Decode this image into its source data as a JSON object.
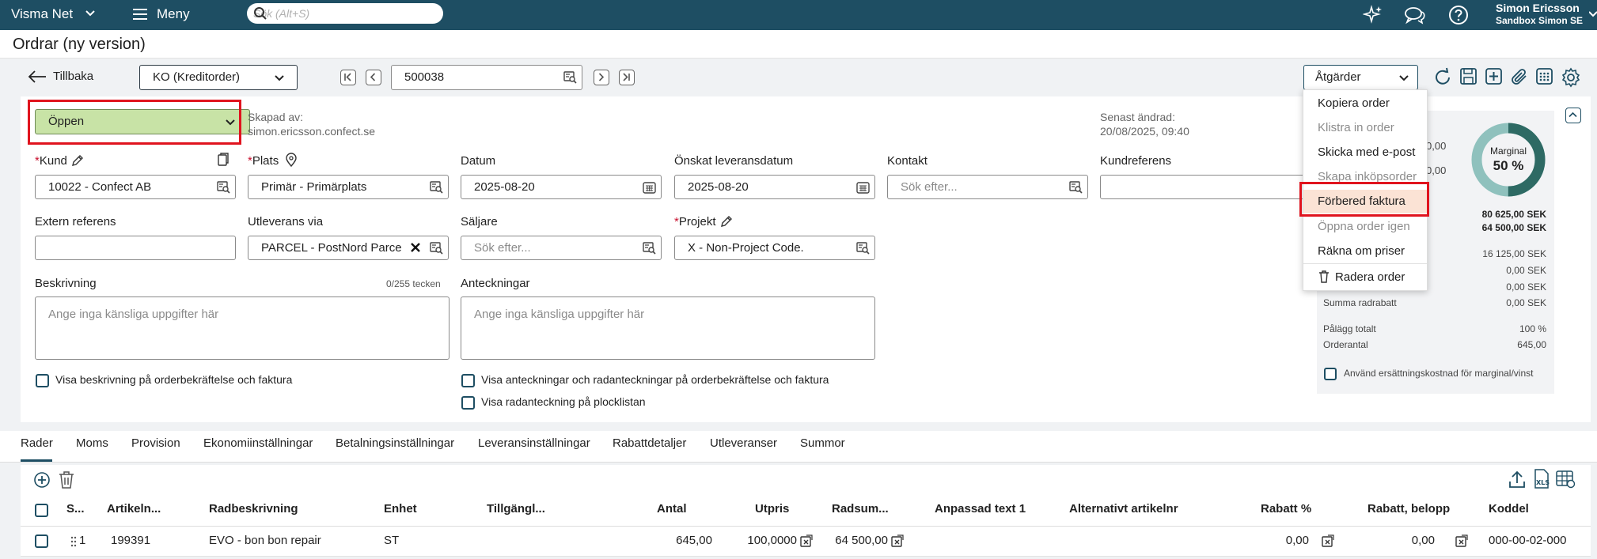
{
  "topbar": {
    "app_name": "Visma Net",
    "menu_label": "Meny",
    "search_placeholder": "Sök (Alt+S)",
    "user_name": "Simon Ericsson",
    "company": "Sandbox Simon SE"
  },
  "page": {
    "title": "Ordrar (ny version)"
  },
  "toolbar": {
    "back_label": "Tillbaka",
    "order_type": "KO (Kreditorder)",
    "order_number": "500038",
    "actions_label": "Åtgärder"
  },
  "actions_menu": {
    "items": [
      {
        "label": "Kopiera order",
        "disabled": false
      },
      {
        "label": "Klistra in order",
        "disabled": true
      },
      {
        "label": "Skicka med e-post",
        "disabled": false
      },
      {
        "label": "Skapa inköpsorder",
        "disabled": true
      },
      {
        "label": "Förbered faktura",
        "disabled": false,
        "highlighted": true
      },
      {
        "label": "Öppna order igen",
        "disabled": true
      },
      {
        "label": "Räkna om priser",
        "disabled": false
      },
      {
        "label": "Radera order",
        "disabled": false,
        "icon": "trash-icon"
      }
    ]
  },
  "header": {
    "status": "Öppen",
    "created_by_label": "Skapad av:",
    "created_by": "simon.ericsson.confect.se",
    "last_changed_label": "Senast ändrad:",
    "last_changed": "20/08/2025, 09:40"
  },
  "fields": {
    "customer": {
      "label": "Kund",
      "value": "10022 - Confect AB"
    },
    "location": {
      "label": "Plats",
      "value": "Primär - Primärplats"
    },
    "date": {
      "label": "Datum",
      "value": "2025-08-20"
    },
    "requested_date": {
      "label": "Önskat leveransdatum",
      "value": "2025-08-20"
    },
    "contact": {
      "label": "Kontakt",
      "placeholder": "Sök efter..."
    },
    "customer_ref": {
      "label": "Kundreferens",
      "value": ""
    },
    "external_ref": {
      "label": "Extern referens",
      "value": ""
    },
    "ship_via": {
      "label": "Utleverans via",
      "value": "PARCEL - PostNord Parce"
    },
    "salesperson": {
      "label": "Säljare",
      "placeholder": "Sök efter..."
    },
    "project": {
      "label": "Projekt",
      "value": "X - Non-Project Code."
    },
    "description": {
      "label": "Beskrivning",
      "counter": "0/255 tecken",
      "placeholder": "Ange inga känsliga uppgifter här"
    },
    "notes": {
      "label": "Anteckningar",
      "placeholder": "Ange inga känsliga uppgifter här"
    }
  },
  "checkboxes": {
    "show_description": "Visa beskrivning på orderbekräftelse och faktura",
    "show_notes": "Visa anteckningar och radanteckningar på orderbekräftelse och faktura",
    "show_line_note": "Visa radanteckning på plocklistan"
  },
  "summary": {
    "margin_label": "Marginal",
    "margin_value": "50 %",
    "margin_fraction": 0.5,
    "partial_values": [
      "0,00",
      "0,00"
    ],
    "total_1": "80 625,00 SEK",
    "total_2": "64 500,00 SEK",
    "rows": [
      {
        "label": "",
        "value": "16 125,00 SEK"
      },
      {
        "label": "",
        "value": "0,00 SEK"
      },
      {
        "label": "",
        "value": "0,00 SEK"
      },
      {
        "label": "Summa radrabatt",
        "value": "0,00 SEK"
      },
      {
        "label": "Pålägg totalt",
        "value": "100 %"
      },
      {
        "label": "Orderantal",
        "value": "645,00"
      }
    ],
    "use_replacement_cost": "Använd ersättningskostnad för marginal/vinst"
  },
  "tabs": [
    "Rader",
    "Moms",
    "Provision",
    "Ekonomiinställningar",
    "Betalningsinställningar",
    "Leveransinställningar",
    "Rabattdetaljer",
    "Utleveranser",
    "Summor"
  ],
  "grid": {
    "columns": [
      "S...",
      "Artikeln...",
      "Radbeskrivning",
      "Enhet",
      "Tillgängl...",
      "Antal",
      "Utpris",
      "Radsum...",
      "Anpassad text 1",
      "Alternativt artikelnr",
      "Rabatt %",
      "Rabatt, belopp",
      "Koddel"
    ],
    "rows": [
      {
        "line": "1",
        "item": "199391",
        "description": "EVO - bon bon repair",
        "unit": "ST",
        "available": "",
        "qty": "645,00",
        "price": "100,0000",
        "amount": "64 500,00",
        "custom1": "",
        "alt_item": "",
        "discount_pct": "0,00",
        "discount_amt": "0,00",
        "code": "000-00-02-000"
      }
    ]
  },
  "colors": {
    "topbar": "#1e4e63",
    "status_green": "#c8e3a6",
    "highlight_red": "#e0141e",
    "menu_highlight": "#fbe3d5",
    "donut_dark": "#2e6a64",
    "donut_light": "#8fc1bd"
  }
}
